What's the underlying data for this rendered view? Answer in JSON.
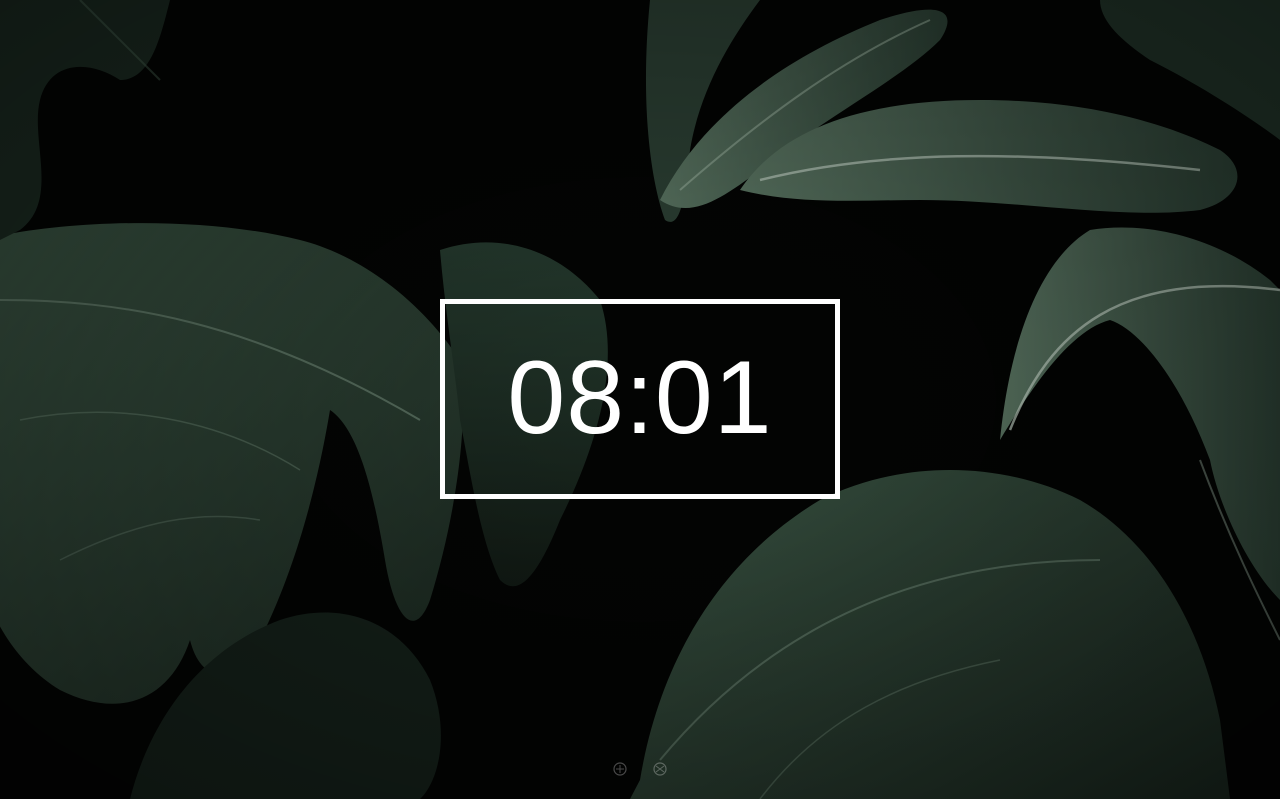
{
  "clock": {
    "time": "08:01"
  },
  "background": {
    "description_icon": "monstera-leaves-photo",
    "colors": {
      "base": "#030403",
      "leaf_dark": "#1c2b22",
      "leaf_mid": "#2f4637",
      "leaf_light": "#4f6b57",
      "vein": "#8fa796",
      "frame": "#ffffff"
    }
  },
  "bottom_icon": "decorative-logo-icon"
}
